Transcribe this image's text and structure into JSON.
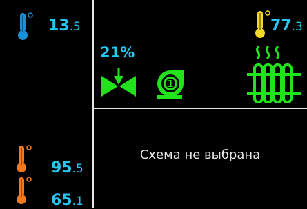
{
  "colors": {
    "background": "#000000",
    "divider": "#e6e6e6",
    "value_cyan": "#27c5f2",
    "thermo_blue": "#1a8fd6",
    "thermo_orange": "#f07a20",
    "thermo_yellow": "#f2d92a",
    "equipment_green": "#22e21c"
  },
  "left_panel": {
    "outdoor": {
      "icon": "thermometer-blue-icon",
      "int": "13",
      "dec": ".5"
    },
    "supply": {
      "icon": "thermometer-orange-icon",
      "int": "95",
      "dec": ".5"
    },
    "return": {
      "icon": "thermometer-orange-icon",
      "int": "65",
      "dec": ".1"
    }
  },
  "circuit": {
    "valve_percent": "21%",
    "valve_icon": "three-way-valve-icon",
    "pump_icon": "circulation-pump-icon",
    "radiator_icon": "radiator-heating-icon",
    "radiator_temp": {
      "icon": "thermometer-yellow-icon",
      "int": "77",
      "dec": ".3"
    }
  },
  "scheme": {
    "status_text": "Схема не выбрана"
  }
}
